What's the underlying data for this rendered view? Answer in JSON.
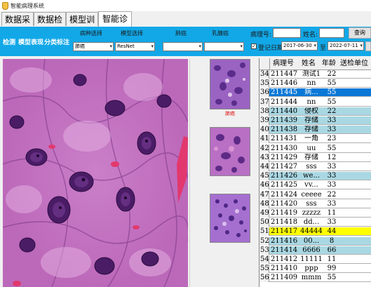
{
  "window": {
    "title": "智能病理系统"
  },
  "tabs": [
    {
      "label": "数据采集",
      "active": false
    },
    {
      "label": "数据检索",
      "active": false
    },
    {
      "label": "模型训练",
      "active": false
    },
    {
      "label": "智能诊断",
      "active": true
    }
  ],
  "toolbar": {
    "links": [
      "检测",
      "模型表现",
      "分类标注"
    ],
    "filters": [
      {
        "label": "病种选择",
        "value": "肺癌"
      },
      {
        "label": "模型选择",
        "value": "ResNet"
      },
      {
        "label": "肺癌",
        "value": ""
      },
      {
        "label": "乳腺癌",
        "value": ""
      }
    ],
    "case_no_label": "病理号:",
    "case_no_value": "",
    "name_label": "姓名:",
    "name_value": "",
    "search_label": "查询",
    "date_check_label": "登记日期",
    "date_checked": true,
    "date_from": "2017-06-30",
    "date_sep": "至",
    "date_to": "2022-07-11"
  },
  "thumbnails": [
    {
      "caption": "肺癌"
    },
    {
      "caption": ""
    },
    {
      "caption": ""
    }
  ],
  "table": {
    "columns": [
      "病理号",
      "姓名",
      "年龄",
      "送检单位"
    ],
    "rows": [
      {
        "n": "34",
        "id": "211447",
        "name": "测试1",
        "age": "22",
        "unit": "",
        "style": "white"
      },
      {
        "n": "35",
        "id": "211446",
        "name": "nn",
        "age": "55",
        "unit": "",
        "style": "white"
      },
      {
        "n": "36",
        "id": "211445",
        "name": "病...",
        "age": "55",
        "unit": "",
        "style": "selected"
      },
      {
        "n": "37",
        "id": "211444",
        "name": "nn",
        "age": "55",
        "unit": "",
        "style": "white"
      },
      {
        "n": "38",
        "id": "211440",
        "name": "侵权",
        "age": "22",
        "unit": "",
        "style": "blue"
      },
      {
        "n": "39",
        "id": "211439",
        "name": "存储",
        "age": "33",
        "unit": "",
        "style": "blue"
      },
      {
        "n": "40",
        "id": "211438",
        "name": "存储",
        "age": "33",
        "unit": "",
        "style": "blue"
      },
      {
        "n": "41",
        "id": "211431",
        "name": "一角",
        "age": "23",
        "unit": "",
        "style": "white"
      },
      {
        "n": "42",
        "id": "211430",
        "name": "uu",
        "age": "55",
        "unit": "",
        "style": "white"
      },
      {
        "n": "43",
        "id": "211429",
        "name": "存储",
        "age": "12",
        "unit": "",
        "style": "white"
      },
      {
        "n": "44",
        "id": "211427",
        "name": "sss",
        "age": "33",
        "unit": "",
        "style": "white"
      },
      {
        "n": "45",
        "id": "211426",
        "name": "we...",
        "age": "33",
        "unit": "",
        "style": "blue"
      },
      {
        "n": "46",
        "id": "211425",
        "name": "vv...",
        "age": "33",
        "unit": "",
        "style": "white"
      },
      {
        "n": "47",
        "id": "211424",
        "name": "ceeee",
        "age": "22",
        "unit": "",
        "style": "white"
      },
      {
        "n": "48",
        "id": "211420",
        "name": "sss",
        "age": "33",
        "unit": "",
        "style": "white"
      },
      {
        "n": "49",
        "id": "211419",
        "name": "zzzzz",
        "age": "11",
        "unit": "",
        "style": "white"
      },
      {
        "n": "50",
        "id": "211418",
        "name": "dd...",
        "age": "33",
        "unit": "",
        "style": "white"
      },
      {
        "n": "51",
        "id": "211417",
        "name": "44444",
        "age": "44",
        "unit": "",
        "style": "yellow"
      },
      {
        "n": "52",
        "id": "211416",
        "name": "00...",
        "age": "8",
        "unit": "",
        "style": "blue"
      },
      {
        "n": "53",
        "id": "211414",
        "name": "6666",
        "age": "66",
        "unit": "",
        "style": "blue"
      },
      {
        "n": "54",
        "id": "211412",
        "name": "11111",
        "age": "11",
        "unit": "",
        "style": "white"
      },
      {
        "n": "55",
        "id": "211410",
        "name": "ppp",
        "age": "99",
        "unit": "",
        "style": "white"
      },
      {
        "n": "56",
        "id": "211409",
        "name": "mmm",
        "age": "55",
        "unit": "",
        "style": "white"
      }
    ]
  },
  "colors": {
    "toolbar": "#12a8e8",
    "row_blue": "#a9d8e3",
    "row_selected": "#0a78d7",
    "row_yellow": "#ffff00",
    "thumb_caption": "#e01010"
  }
}
